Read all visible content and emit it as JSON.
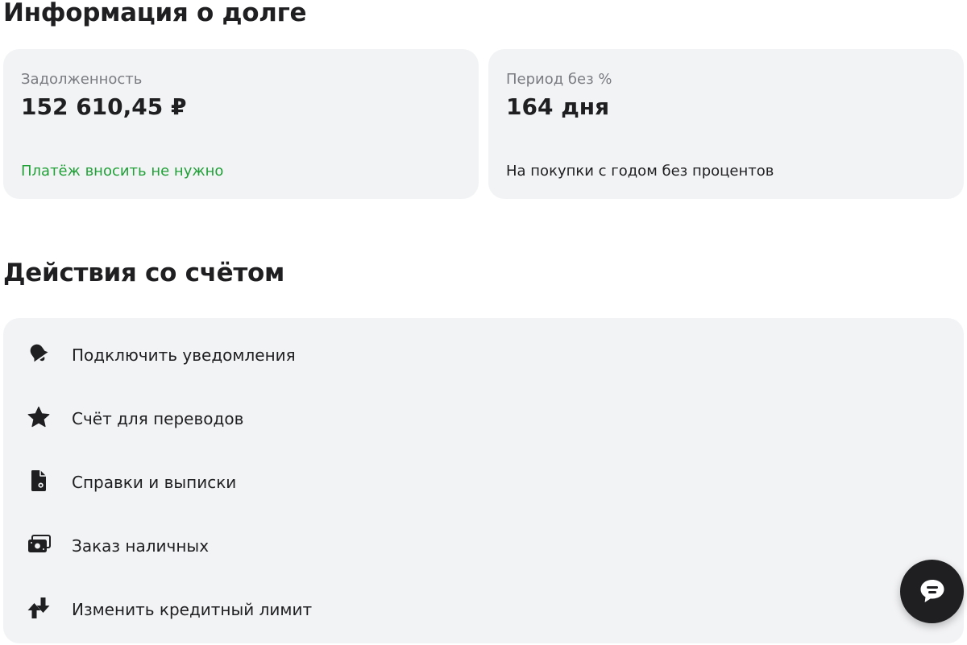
{
  "debt_section": {
    "title": "Информация о долге",
    "debt_card": {
      "label": "Задолженность",
      "value": "152 610,45 ₽",
      "note": "Платёж вносить не нужно",
      "note_color": "#21a038"
    },
    "period_card": {
      "label": "Период без %",
      "value": "164 дня",
      "note": "На покупки с годом без процентов"
    }
  },
  "actions_section": {
    "title": "Действия со счётом",
    "items": [
      {
        "label": "Подключить уведомления",
        "icon": "bell-icon"
      },
      {
        "label": "Счёт для переводов",
        "icon": "star-icon"
      },
      {
        "label": "Справки и выписки",
        "icon": "document-icon"
      },
      {
        "label": "Заказ наличных",
        "icon": "cash-icon"
      },
      {
        "label": "Изменить кредитный лимит",
        "icon": "arrows-up-down-icon"
      }
    ]
  },
  "chat": {
    "icon": "chat-icon"
  },
  "colors": {
    "card_background": "#f2f3f5",
    "text_primary": "#1f1f22",
    "text_secondary": "#7a7c82",
    "accent_green": "#21a038",
    "chat_button": "#1f1f22"
  }
}
